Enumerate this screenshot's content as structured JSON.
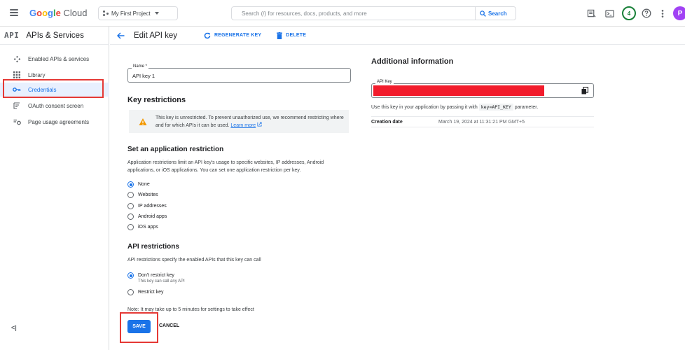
{
  "topbar": {
    "logo_google": "Google",
    "logo_cloud": "Cloud",
    "project": "My First Project",
    "search_placeholder": "Search (/) for resources, docs, products, and more",
    "search_button": "Search",
    "notifications_count": "4",
    "avatar_letter": "P"
  },
  "sidebar": {
    "api_logo": "API",
    "title": "APIs & Services",
    "items": [
      {
        "label": "Enabled APIs & services",
        "icon": "diamond-api-icon"
      },
      {
        "label": "Library",
        "icon": "library-grid-icon"
      },
      {
        "label": "Credentials",
        "icon": "key-icon"
      },
      {
        "label": "OAuth consent screen",
        "icon": "consent-screen-icon"
      },
      {
        "label": "Page usage agreements",
        "icon": "settings-agreement-icon"
      }
    ],
    "collapse": "<|"
  },
  "header": {
    "title": "Edit API key",
    "regenerate": "REGENERATE KEY",
    "delete": "DELETE"
  },
  "form": {
    "name_label": "Name *",
    "name_value": "API key 1",
    "key_restrictions_title": "Key restrictions",
    "warning_text": "This key is unrestricted. To prevent unauthorized use, we recommend restricting where and for which APIs it can be used.",
    "learn_more": "Learn more",
    "app_restriction_title": "Set an application restriction",
    "app_restriction_desc": "Application restrictions limit an API key's usage to specific websites, IP addresses, Android applications, or iOS applications. You can set one application restriction per key.",
    "app_options": [
      "None",
      "Websites",
      "IP addresses",
      "Android apps",
      "iOS apps"
    ],
    "app_selected": "None",
    "api_restrictions_title": "API restrictions",
    "api_restrictions_desc": "API restrictions specify the enabled APIs that this key can call",
    "api_options": [
      {
        "label": "Don't restrict key",
        "sub": "This key can call any API"
      },
      {
        "label": "Restrict key",
        "sub": ""
      }
    ],
    "api_selected": "Don't restrict key",
    "note": "Note: It may take up to 5 minutes for settings to take effect",
    "save": "SAVE",
    "cancel": "CANCEL"
  },
  "additional": {
    "title": "Additional information",
    "api_key_label": "API Key",
    "usage_prefix": "Use this key in your application by passing it with",
    "usage_code": "key=API_KEY",
    "usage_suffix": "parameter.",
    "creation_label": "Creation date",
    "creation_value": "March 19, 2024 at 11:31:21 PM GMT+5"
  },
  "colors": {
    "accent": "#1a73e8",
    "highlight": "#e53935",
    "redacted": "#f21c2c",
    "warning": "#f29900"
  }
}
